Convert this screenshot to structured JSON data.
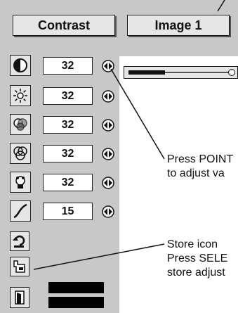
{
  "top": {
    "contrast_label": "Contrast",
    "image_label": "Image 1"
  },
  "rows": [
    {
      "icon": "contrast-icon",
      "value": "32"
    },
    {
      "icon": "brightness-icon",
      "value": "32"
    },
    {
      "icon": "color-icon",
      "value": "32"
    },
    {
      "icon": "tint-icon",
      "value": "32"
    },
    {
      "icon": "white-balance-icon",
      "value": "32"
    },
    {
      "icon": "gamma-icon",
      "value": "15"
    }
  ],
  "slider": {
    "level": 0.35
  },
  "callouts": {
    "pointer_line1": "Press POINT",
    "pointer_line2": "to adjust va",
    "store_line1": "Store icon",
    "store_line2": "Press SELE",
    "store_line3": "store adjust"
  },
  "colors": {
    "panel": "#c8c8c8",
    "button": "#e6e6e6",
    "ink": "#111111"
  }
}
